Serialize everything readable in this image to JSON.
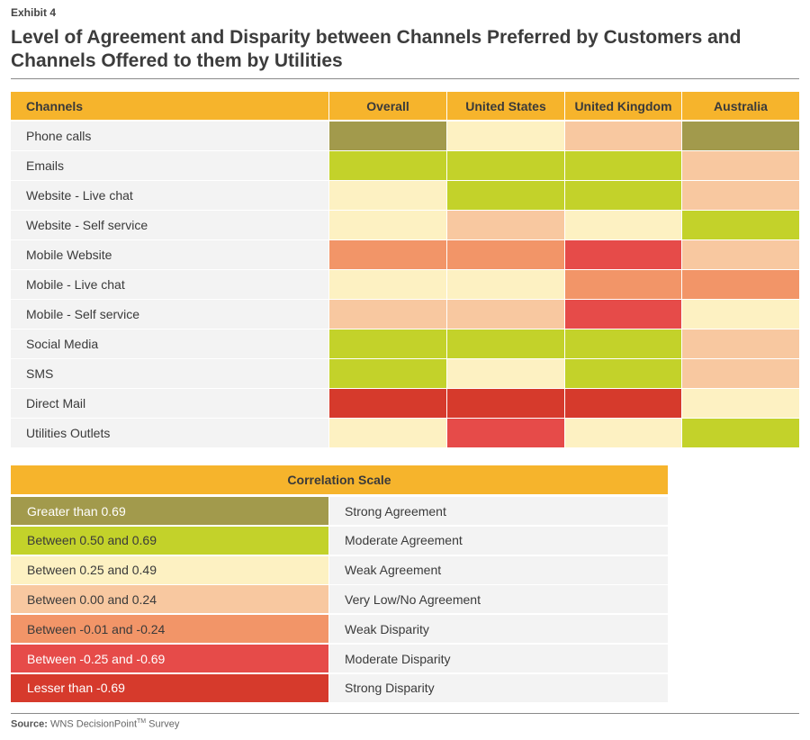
{
  "exhibit": "Exhibit 4",
  "title": "Level of Agreement and Disparity between Channels Preferred by Customers and Channels Offered to them by Utilities",
  "source": {
    "label": "Source:",
    "text": "WNS DecisionPoint",
    "superscript": "TM",
    "suffix": " Survey"
  },
  "colors": {
    "header": "#f6b42c",
    "levels": {
      "strong_agreement": "#a29a4c",
      "moderate_agreement": "#c3d22a",
      "weak_agreement": "#fdf1c2",
      "very_low_agreement": "#f8c8a0",
      "weak_disparity": "#f29568",
      "moderate_disparity": "#e64b49",
      "strong_disparity": "#d63a2c"
    }
  },
  "chart_data": {
    "type": "heatmap",
    "row_header": "Channels",
    "columns": [
      "Overall",
      "United States",
      "United Kingdom",
      "Australia"
    ],
    "rows": [
      {
        "channel": "Phone calls",
        "levels": [
          "strong_agreement",
          "weak_agreement",
          "very_low_agreement",
          "strong_agreement"
        ]
      },
      {
        "channel": "Emails",
        "levels": [
          "moderate_agreement",
          "moderate_agreement",
          "moderate_agreement",
          "very_low_agreement"
        ]
      },
      {
        "channel": "Website - Live chat",
        "levels": [
          "weak_agreement",
          "moderate_agreement",
          "moderate_agreement",
          "very_low_agreement"
        ]
      },
      {
        "channel": "Website - Self service",
        "levels": [
          "weak_agreement",
          "very_low_agreement",
          "weak_agreement",
          "moderate_agreement"
        ]
      },
      {
        "channel": "Mobile Website",
        "levels": [
          "weak_disparity",
          "weak_disparity",
          "moderate_disparity",
          "very_low_agreement"
        ]
      },
      {
        "channel": "Mobile - Live chat",
        "levels": [
          "weak_agreement",
          "weak_agreement",
          "weak_disparity",
          "weak_disparity"
        ]
      },
      {
        "channel": "Mobile - Self service",
        "levels": [
          "very_low_agreement",
          "very_low_agreement",
          "moderate_disparity",
          "weak_agreement"
        ]
      },
      {
        "channel": "Social Media",
        "levels": [
          "moderate_agreement",
          "moderate_agreement",
          "moderate_agreement",
          "very_low_agreement"
        ]
      },
      {
        "channel": "SMS",
        "levels": [
          "moderate_agreement",
          "weak_agreement",
          "moderate_agreement",
          "very_low_agreement"
        ]
      },
      {
        "channel": "Direct Mail",
        "levels": [
          "strong_disparity",
          "strong_disparity",
          "strong_disparity",
          "weak_agreement"
        ]
      },
      {
        "channel": "Utilities Outlets",
        "levels": [
          "weak_agreement",
          "moderate_disparity",
          "weak_agreement",
          "moderate_agreement"
        ]
      }
    ],
    "scale": {
      "title": "Correlation Scale",
      "items": [
        {
          "level": "strong_agreement",
          "range": "Greater than 0.69",
          "label": "Strong Agreement",
          "text_color": "#ffffff"
        },
        {
          "level": "moderate_agreement",
          "range": "Between 0.50 and 0.69",
          "label": "Moderate Agreement",
          "text_color": "#3a3a3a"
        },
        {
          "level": "weak_agreement",
          "range": "Between 0.25 and 0.49",
          "label": "Weak Agreement",
          "text_color": "#3a3a3a"
        },
        {
          "level": "very_low_agreement",
          "range": "Between 0.00 and 0.24",
          "label": "Very Low/No Agreement",
          "text_color": "#3a3a3a"
        },
        {
          "level": "weak_disparity",
          "range": "Between -0.01 and -0.24",
          "label": "Weak Disparity",
          "text_color": "#3a3a3a"
        },
        {
          "level": "moderate_disparity",
          "range": "Between -0.25 and -0.69",
          "label": "Moderate Disparity",
          "text_color": "#ffffff"
        },
        {
          "level": "strong_disparity",
          "range": "Lesser than -0.69",
          "label": "Strong Disparity",
          "text_color": "#ffffff"
        }
      ]
    }
  }
}
